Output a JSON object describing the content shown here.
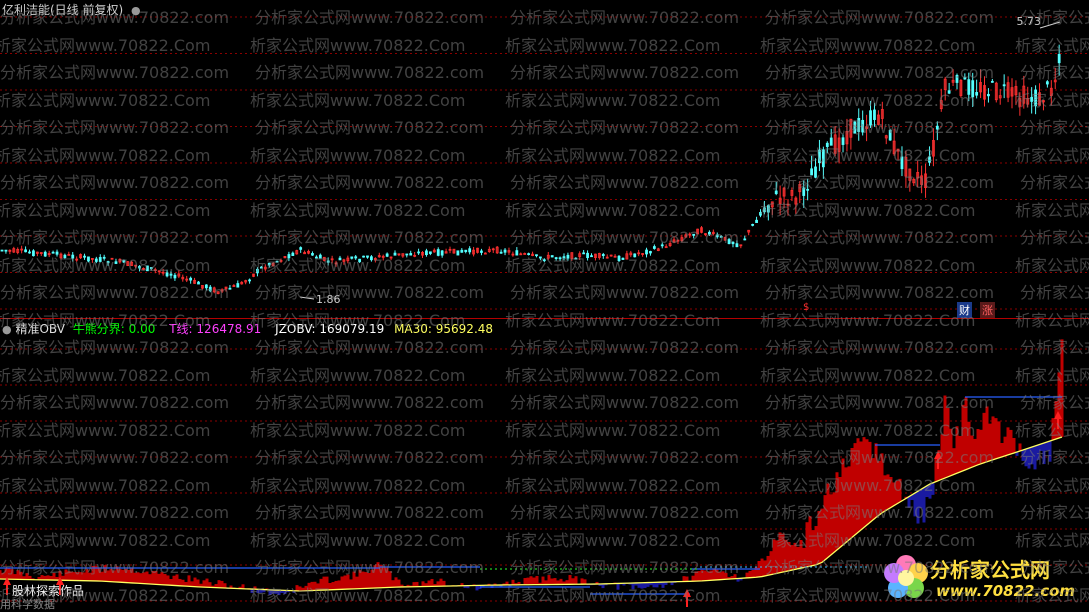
{
  "price_panel": {
    "title": "亿利洁能(日线 前复权)",
    "high_label": "5.73",
    "low_label": "1.86",
    "markers": {
      "fin": "财",
      "rise": "涨",
      "dollar": "$"
    }
  },
  "indicator_panel": {
    "name": "精准OBV",
    "bull_label": "牛熊分界:",
    "bull_value": "0.00",
    "t_label": "T线:",
    "t_value": "126478.91",
    "jz_label": "JZOBV:",
    "jz_value": "169079.19",
    "ma_label": "MA30:",
    "ma_value": "95692.48",
    "footer_note": "股林探索作品",
    "footer_sub": "用科学数据"
  },
  "watermark": {
    "text_cn": "分析家公式网www.70822.com",
    "text_short": "析家公式网www.70822.Com"
  },
  "logo": {
    "title": "分析家公式网",
    "url": "www.70822.com"
  },
  "colors": {
    "up": "#ff3030",
    "down": "#54ffff",
    "obv_fill_up": "#c00000",
    "obv_fill_down": "#1a1aa0",
    "ma_line": "#ffff60",
    "flat_line": "#2860ff",
    "grid": "#8b0000",
    "bull": "#00ff00",
    "t_line": "#ff40ff",
    "jz_text": "#ffffff",
    "ma_text": "#ffff60"
  }
}
